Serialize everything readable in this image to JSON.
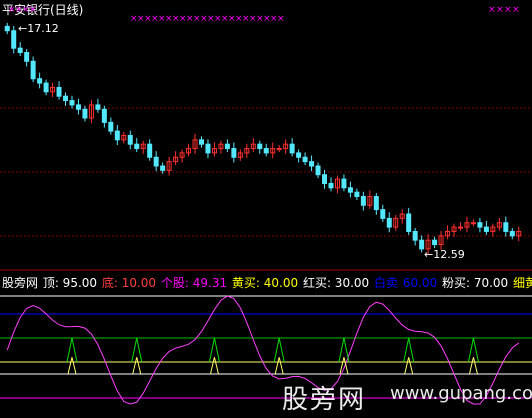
{
  "title": "平安银行(日线)",
  "chart_data": {
    "type": "candlestick",
    "panels": [
      {
        "name": "price",
        "annotations": [
          {
            "label": "17.12"
          },
          {
            "label": "12.59"
          }
        ],
        "dashed_levels": 3,
        "top_markers": "magenta x markers above bars"
      },
      {
        "name": "indicator",
        "horizontal_levels": [
          95,
          80,
          60,
          30,
          40,
          10
        ],
        "level_colors": {
          "95": "#ffffff",
          "80": "#0000ff",
          "60": "#00c000",
          "30": "#ffffff",
          "40": "#ffff66",
          "10": "#ff00ff"
        }
      }
    ],
    "close": [
      17.6,
      17.2,
      17.1,
      16.9,
      16.5,
      16.4,
      16.2,
      16.3,
      16.1,
      16.0,
      15.9,
      15.8,
      15.6,
      15.9,
      15.8,
      15.5,
      15.3,
      15.1,
      15.2,
      15.0,
      14.9,
      15.0,
      14.7,
      14.5,
      14.4,
      14.6,
      14.7,
      14.8,
      14.9,
      15.1,
      15.0,
      14.8,
      14.9,
      15.0,
      14.9,
      14.7,
      14.8,
      14.9,
      15.0,
      14.9,
      14.8,
      14.9,
      14.9,
      15.0,
      14.8,
      14.7,
      14.6,
      14.5,
      14.3,
      14.1,
      14.0,
      14.2,
      14.0,
      13.9,
      13.8,
      13.6,
      13.8,
      13.5,
      13.3,
      13.1,
      13.3,
      13.4,
      13.0,
      12.8,
      12.6,
      12.8,
      12.7,
      12.9,
      13.0,
      13.1,
      13.1,
      13.2,
      13.2,
      13.1,
      13.0,
      13.1,
      13.2,
      13.0,
      12.9,
      13.0
    ]
  },
  "legend": [
    {
      "text": "股旁网",
      "color": "#ffffff"
    },
    {
      "text": "顶: 95.00",
      "color": "#ffffff"
    },
    {
      "text": "底: 10.00",
      "color": "#ff4040"
    },
    {
      "text": "个股: 49.31",
      "color": "#ff00ff"
    },
    {
      "text": "黄买: 40.00",
      "color": "#ffff00"
    },
    {
      "text": "红买: 30.00",
      "color": "#ffffff"
    },
    {
      "text": "白卖",
      "color": "#0000ff"
    },
    {
      "text": "60.00",
      "color": "#0000ff"
    },
    {
      "text": "粉买: 70.00",
      "color": "#ffffff"
    },
    {
      "text": "细黄",
      "color": "#ffff00"
    }
  ],
  "watermark": "股旁网",
  "watermark_url": "www.gupang.com",
  "colors": {
    "up": "#ff3030",
    "down": "#54e8ff",
    "bg": "#000000",
    "grid": "#800000"
  }
}
